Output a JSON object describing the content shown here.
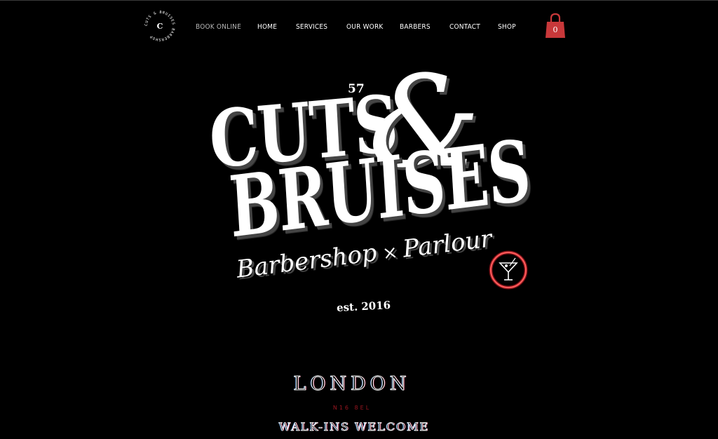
{
  "brand": {
    "badge_text": "CUTS & BRUISES BARBERSHOP",
    "badge_letter": "C",
    "number": "57",
    "title_line1": "CUTS",
    "ampersand": "&",
    "title_line2": "BRUISES",
    "tagline_left": "Barbershop",
    "tagline_sep": "×",
    "tagline_right": "Parlour",
    "established": "est. 2016"
  },
  "nav": {
    "items": [
      {
        "label": "BOOK ONLINE"
      },
      {
        "label": "HOME"
      },
      {
        "label": "SERVICES"
      },
      {
        "label": "OUR WORK"
      },
      {
        "label": "BARBERS"
      },
      {
        "label": "CONTACT"
      },
      {
        "label": "SHOP"
      }
    ]
  },
  "cart": {
    "count": "0",
    "icon": "shopping-bag-icon",
    "color": "#c8383a"
  },
  "location": {
    "city": "LONDON",
    "postcode": "N16 8EL",
    "walkins": "WALK-INS WELCOME"
  },
  "colors": {
    "background": "#000000",
    "neon_red": "#e0202a",
    "postcode_red": "#9a1620"
  }
}
